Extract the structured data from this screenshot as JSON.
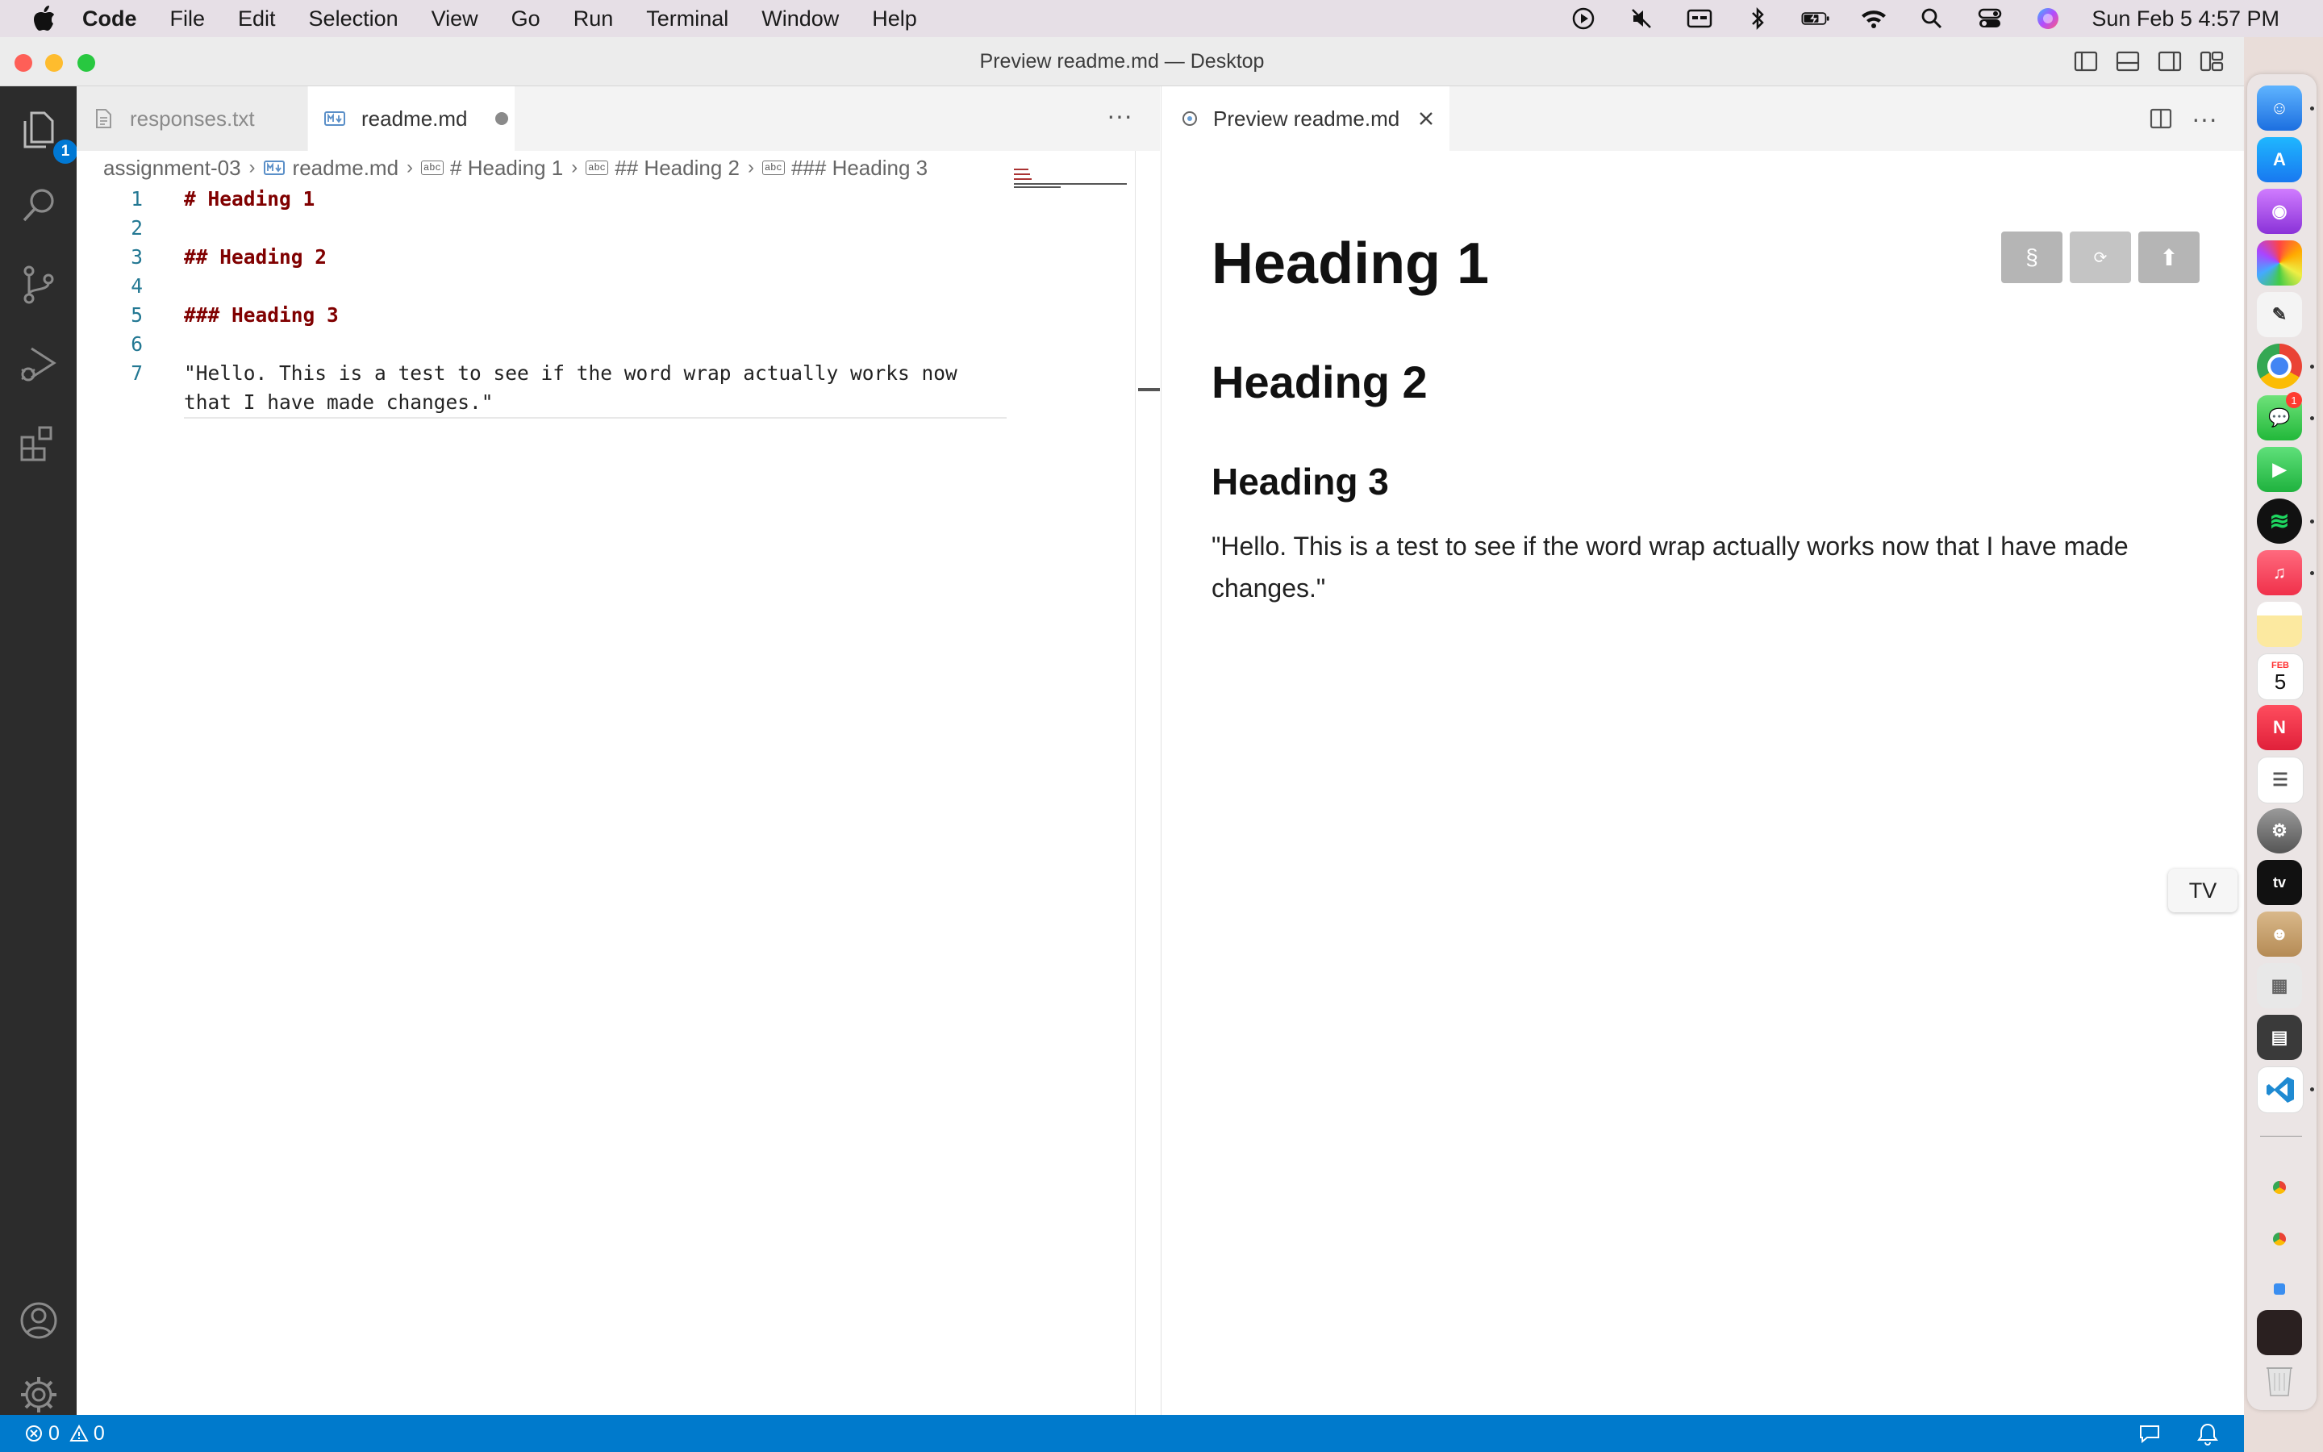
{
  "menubar": {
    "app_name": "Code",
    "items": [
      "File",
      "Edit",
      "Selection",
      "View",
      "Go",
      "Run",
      "Terminal",
      "Window",
      "Help"
    ],
    "clock": "Sun Feb 5  4:57 PM",
    "status_icons": [
      "play-circle-icon",
      "mute-icon",
      "caption-icon",
      "bluetooth-icon",
      "battery-icon",
      "wifi-icon",
      "spotlight-icon",
      "control-center-icon",
      "siri-icon"
    ]
  },
  "window": {
    "title": "Preview readme.md — Desktop"
  },
  "activitybar": {
    "explorer_badge": "1",
    "icons": [
      "files-icon",
      "search-icon",
      "source-control-icon",
      "run-debug-icon",
      "extensions-icon",
      "account-icon",
      "settings-gear-icon"
    ]
  },
  "editor": {
    "tabs": [
      {
        "label": "responses.txt",
        "active": false
      },
      {
        "label": "readme.md",
        "active": true,
        "dirty": true
      }
    ],
    "breadcrumb": [
      "assignment-03",
      "readme.md",
      "# Heading 1",
      "## Heading 2",
      "### Heading 3"
    ],
    "lines": [
      {
        "number": "1",
        "text": "# Heading 1",
        "kind": "heading"
      },
      {
        "number": "2",
        "text": "",
        "kind": "blank"
      },
      {
        "number": "3",
        "text": "## Heading 2",
        "kind": "heading"
      },
      {
        "number": "4",
        "text": "",
        "kind": "blank"
      },
      {
        "number": "5",
        "text": "### Heading 3",
        "kind": "heading"
      },
      {
        "number": "6",
        "text": "",
        "kind": "blank"
      },
      {
        "number": "7",
        "text": "\"Hello. This is a test to see if the word wrap actually works now",
        "kind": "text"
      },
      {
        "number": "",
        "text": "that I have made changes.\"",
        "kind": "text"
      }
    ]
  },
  "preview": {
    "tab_label": "Preview readme.md",
    "h1": "Heading 1",
    "h2": "Heading 2",
    "h3": "Heading 3",
    "paragraph": "\"Hello. This is a test to see if the word wrap actually works now that I have made changes.\"",
    "buttons": [
      "§",
      "⟳",
      "⬆"
    ]
  },
  "tooltip": {
    "text": "TV"
  },
  "statusbar": {
    "errors": "0",
    "warnings": "0"
  },
  "dock": {
    "apps": [
      "Finder",
      "App Store",
      "Podcasts",
      "Photos",
      "TextEdit",
      "Chrome",
      "Messages",
      "FaceTime",
      "Spotify",
      "Music",
      "Notes",
      "Calendar",
      "News",
      "Reminders",
      "System Settings",
      "TV",
      "Contacts",
      "Launchpad",
      "Calculator",
      "VS Code"
    ],
    "calendar_month": "FEB",
    "calendar_day": "5",
    "messages_badge": "1"
  },
  "colors": {
    "accent": "#007acc",
    "heading_code": "#800000",
    "line_number": "#237893"
  }
}
